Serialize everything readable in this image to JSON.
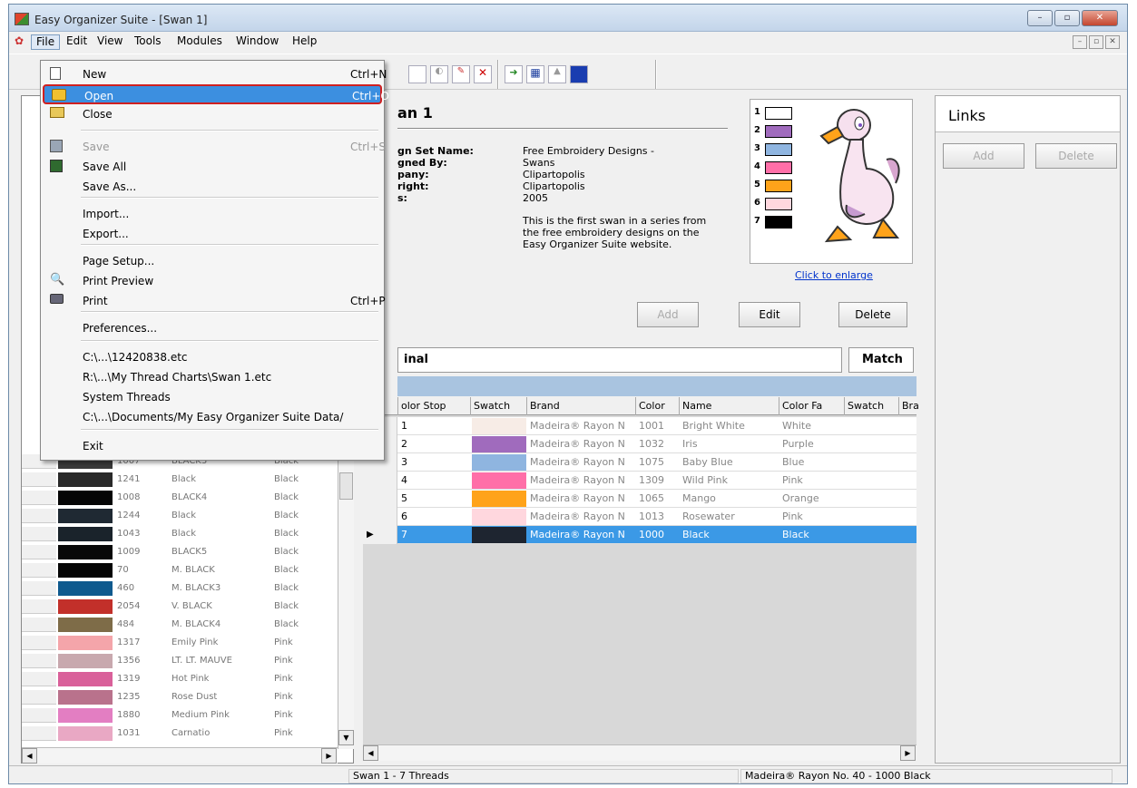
{
  "window": {
    "title": "Easy Organizer Suite - [Swan 1]"
  },
  "menubar": [
    "File",
    "Edit",
    "View",
    "Tools",
    "Modules",
    "Window",
    "Help"
  ],
  "file_menu": [
    {
      "label": "New",
      "shortcut": "Ctrl+N"
    },
    {
      "label": "Open",
      "shortcut": "Ctrl+O",
      "highlighted": true
    },
    {
      "label": "Close"
    },
    {
      "label": "Save",
      "shortcut": "Ctrl+S",
      "disabled": true
    },
    {
      "label": "Save All"
    },
    {
      "label": "Save As..."
    },
    {
      "label": "Import..."
    },
    {
      "label": "Export..."
    },
    {
      "label": "Page Setup..."
    },
    {
      "label": "Print Preview"
    },
    {
      "label": "Print",
      "shortcut": "Ctrl+P"
    },
    {
      "label": "Preferences..."
    },
    {
      "label": "C:\\...\\12420838.etc"
    },
    {
      "label": "R:\\...\\My Thread Charts\\Swan 1.etc"
    },
    {
      "label": "System Threads"
    },
    {
      "label": "C:\\...\\Documents/My Easy Organizer Suite Data/"
    },
    {
      "label": "Exit"
    }
  ],
  "left_threads": [
    {
      "color": "#3a3a3a",
      "number": "1007",
      "name": "BLACK3",
      "family": "Black"
    },
    {
      "color": "#2a2a2a",
      "number": "1241",
      "name": "Black",
      "family": "Black"
    },
    {
      "color": "#050505",
      "number": "1008",
      "name": "BLACK4",
      "family": "Black"
    },
    {
      "color": "#1f2933",
      "number": "1244",
      "name": "Black",
      "family": "Black"
    },
    {
      "color": "#1a232b",
      "number": "1043",
      "name": "Black",
      "family": "Black"
    },
    {
      "color": "#080808",
      "number": "1009",
      "name": "BLACK5",
      "family": "Black"
    },
    {
      "color": "#050505",
      "number": "70",
      "name": "M. BLACK",
      "family": "Black"
    },
    {
      "color": "#0f5a8e",
      "number": "460",
      "name": "M. BLACK3",
      "family": "Black"
    },
    {
      "color": "#c2302a",
      "number": "2054",
      "name": "V. BLACK",
      "family": "Black"
    },
    {
      "color": "#7e6c48",
      "number": "484",
      "name": "M. BLACK4",
      "family": "Black"
    },
    {
      "color": "#f4a5aa",
      "number": "1317",
      "name": "Emily Pink",
      "family": "Pink"
    },
    {
      "color": "#c8a8ae",
      "number": "1356",
      "name": "LT. LT. MAUVE",
      "family": "Pink"
    },
    {
      "color": "#d9609a",
      "number": "1319",
      "name": "Hot Pink",
      "family": "Pink"
    },
    {
      "color": "#b9728c",
      "number": "1235",
      "name": "Rose Dust",
      "family": "Pink"
    },
    {
      "color": "#e37ec2",
      "number": "1880",
      "name": "Medium Pink",
      "family": "Pink"
    },
    {
      "color": "#e9a8c4",
      "number": "1031",
      "name": "Carnatio",
      "family": "Pink"
    }
  ],
  "design": {
    "title": "an 1",
    "fields": [
      {
        "label": "gn Set Name:",
        "value": "Free Embroidery Designs -"
      },
      {
        "label": "gned By:",
        "value": "Swans"
      },
      {
        "label": "pany:",
        "value": "Clipartopolis"
      },
      {
        "label": "right:",
        "value": "Clipartopolis"
      },
      {
        "label": "s:",
        "value": "2005"
      }
    ],
    "notes": "This is the first swan in a series from the free embroidery designs on the Easy Organizer Suite website.",
    "enlarge_link": "Click to enlarge",
    "buttons": {
      "add": "Add",
      "edit": "Edit",
      "delete": "Delete"
    }
  },
  "stops": [
    {
      "n": "1",
      "color": "#ffffff"
    },
    {
      "n": "2",
      "color": "#a06bbd"
    },
    {
      "n": "3",
      "color": "#8fb5e0"
    },
    {
      "n": "4",
      "color": "#ff6fa8"
    },
    {
      "n": "5",
      "color": "#ffa31a"
    },
    {
      "n": "6",
      "color": "#ffd7de"
    },
    {
      "n": "7",
      "color": "#000000"
    }
  ],
  "original_label": "inal",
  "match_label": "Match",
  "grid": {
    "headers": [
      "olor Stop",
      "Swatch",
      "Brand",
      "Color",
      "Name",
      "Color Fa",
      "Swatch",
      "Bra"
    ],
    "rows": [
      {
        "stop": "1",
        "swatch": "#f7ece6",
        "brand": "Madeira® Rayon N",
        "color": "1001",
        "name": "Bright White",
        "family": "White"
      },
      {
        "stop": "2",
        "swatch": "#a06bbd",
        "brand": "Madeira® Rayon N",
        "color": "1032",
        "name": "Iris",
        "family": "Purple"
      },
      {
        "stop": "3",
        "swatch": "#8fb5e0",
        "brand": "Madeira® Rayon N",
        "color": "1075",
        "name": "Baby Blue",
        "family": "Blue"
      },
      {
        "stop": "4",
        "swatch": "#ff6fa8",
        "brand": "Madeira® Rayon N",
        "color": "1309",
        "name": "Wild Pink",
        "family": "Pink"
      },
      {
        "stop": "5",
        "swatch": "#ffa31a",
        "brand": "Madeira® Rayon N",
        "color": "1065",
        "name": "Mango",
        "family": "Orange"
      },
      {
        "stop": "6",
        "swatch": "#ffd7de",
        "brand": "Madeira® Rayon N",
        "color": "1013",
        "name": "Rosewater",
        "family": "Pink"
      },
      {
        "stop": "7",
        "swatch": "#1e2530",
        "brand": "Madeira® Rayon N",
        "color": "1000",
        "name": "Black",
        "family": "Black",
        "selected": true
      }
    ]
  },
  "links": {
    "title": "Links",
    "add": "Add",
    "delete": "Delete"
  },
  "status": {
    "left": "Swan 1 - 7 Threads",
    "right": "Madeira® Rayon No. 40 - 1000 Black"
  },
  "colors": {
    "selection": "#3b99e6",
    "highlight_border": "#d02020",
    "titlebar": "#c3d5ea"
  }
}
